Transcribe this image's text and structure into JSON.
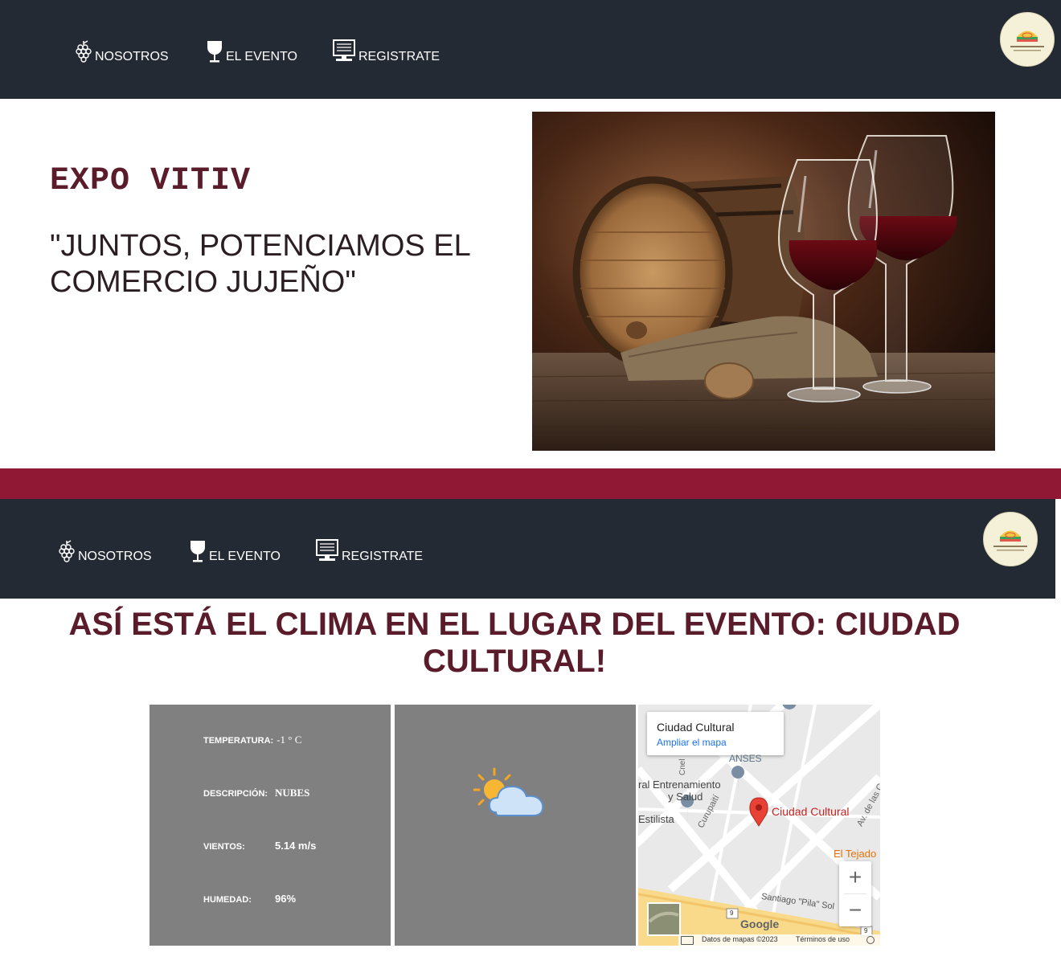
{
  "nav": {
    "items": [
      {
        "label": "NOSOTROS",
        "icon": "grapes-icon"
      },
      {
        "label": "EL EVENTO",
        "icon": "wine-glass-icon"
      },
      {
        "label": "REGISTRATE",
        "icon": "computer-icon"
      }
    ],
    "logo_icon": "government-logo"
  },
  "hero": {
    "title": "EXPO VITIV",
    "slogan": "\"JUNTOS, POTENCIAMOS EL COMERCIO JUJEÑO\"",
    "image": "wine-barrel-and-glasses-photo"
  },
  "weather": {
    "title": "ASÍ ESTÁ EL CLIMA EN EL LUGAR DEL EVENTO: CIUDAD CULTURAL!",
    "rows": [
      {
        "label": "TEMPERATURA:",
        "value": "-1 ° C"
      },
      {
        "label": "DESCRIPCIÓN:",
        "value": "NUBES"
      },
      {
        "label": "VIENTOS:",
        "value": "5.14 m/s"
      },
      {
        "label": "HUMEDAD:",
        "value": "96%"
      }
    ],
    "icon": "partly-cloudy-icon"
  },
  "map": {
    "card_title": "Ciudad Cultural",
    "card_link": "Ampliar el mapa",
    "marker_label": "Ciudad Cultural",
    "labels": {
      "anses": "ANSES",
      "entrenamiento": "ral Entrenamiento",
      "salud": "y Salud",
      "estilista": "Estilista",
      "curupaiti": "Curupaití",
      "cnel": "Cnel",
      "av_cara": "Av. de las Cara",
      "tejado": "El Tejado",
      "santiago": "Santiago \"Pila\" Sol",
      "route": "9",
      "google": "Google"
    },
    "footer_data": "Datos de mapas ©2023",
    "footer_terms": "Términos de uso",
    "zoom_in": "+",
    "zoom_out": "−"
  },
  "colors": {
    "navbar": "#242a33",
    "accent_band": "#911834",
    "title_maroon": "#5a1b2b",
    "panel_gray": "#808080"
  }
}
